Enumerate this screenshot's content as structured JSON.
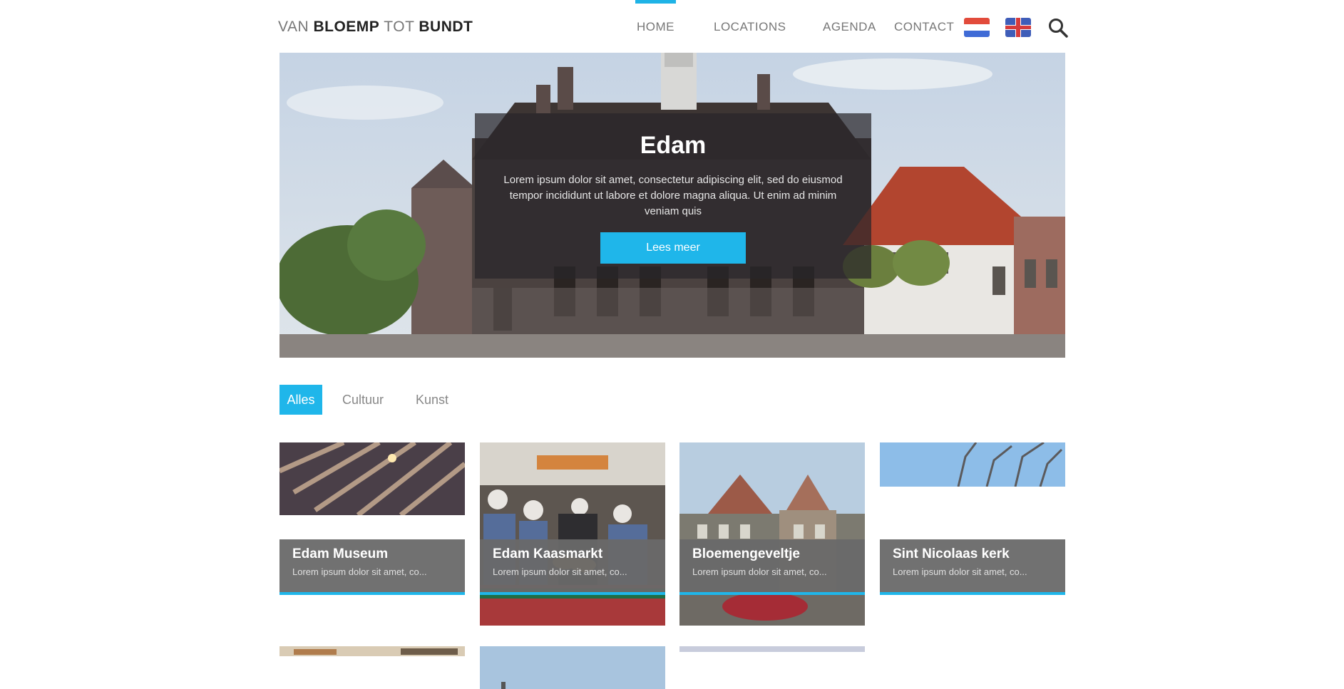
{
  "header": {
    "logo": {
      "part1": "VAN",
      "part2": "BLOEMP",
      "part3": "TOT",
      "part4": "BUNDT"
    },
    "nav": [
      {
        "label": "HOME"
      },
      {
        "label": "LOCATIONS"
      },
      {
        "label": "AGENDA"
      },
      {
        "label": "CONTACT"
      }
    ],
    "icons": {
      "flag_nl": "netherlands-flag-icon",
      "flag_en": "uk-flag-icon",
      "search": "search-icon"
    },
    "accent": "#1fb3e6"
  },
  "hero": {
    "title": "Edam",
    "text": "Lorem ipsum dolor sit amet, consectetur adipiscing elit, sed do eiusmod tempor incididunt ut labore et dolore magna aliqua. Ut enim ad minim veniam quis",
    "button": "Lees meer"
  },
  "filters": [
    {
      "label": "Alles"
    },
    {
      "label": "Cultuur"
    },
    {
      "label": "Kunst"
    }
  ],
  "cards": [
    {
      "title": "Edam Museum",
      "text": "Lorem ipsum dolor sit amet, co..."
    },
    {
      "title": "Edam Kaasmarkt",
      "text": "Lorem ipsum dolor sit amet, co..."
    },
    {
      "title": "Bloemengeveltje",
      "text": "Lorem ipsum dolor sit amet, co..."
    },
    {
      "title": "Sint Nicolaas kerk",
      "text": "Lorem ipsum dolor sit amet, co..."
    }
  ]
}
